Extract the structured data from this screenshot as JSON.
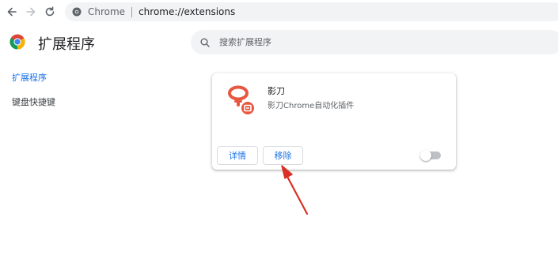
{
  "browser": {
    "site_name": "Chrome",
    "url": "chrome://extensions",
    "icons": [
      "back-arrow-icon",
      "forward-arrow-icon",
      "reload-icon",
      "chrome-site-icon"
    ]
  },
  "header": {
    "title": "扩展程序",
    "search_placeholder": "搜索扩展程序"
  },
  "sidebar": {
    "items": [
      {
        "label": "扩展程序",
        "active": true
      },
      {
        "label": "键盘快捷键",
        "active": false
      }
    ]
  },
  "extension": {
    "name": "影刀",
    "description": "影刀Chrome自动化插件",
    "details_label": "详情",
    "remove_label": "移除",
    "enabled": false,
    "icon_color": "#e8573f"
  },
  "colors": {
    "accent": "#1a73e8",
    "annotation_arrow": "#d93025"
  }
}
